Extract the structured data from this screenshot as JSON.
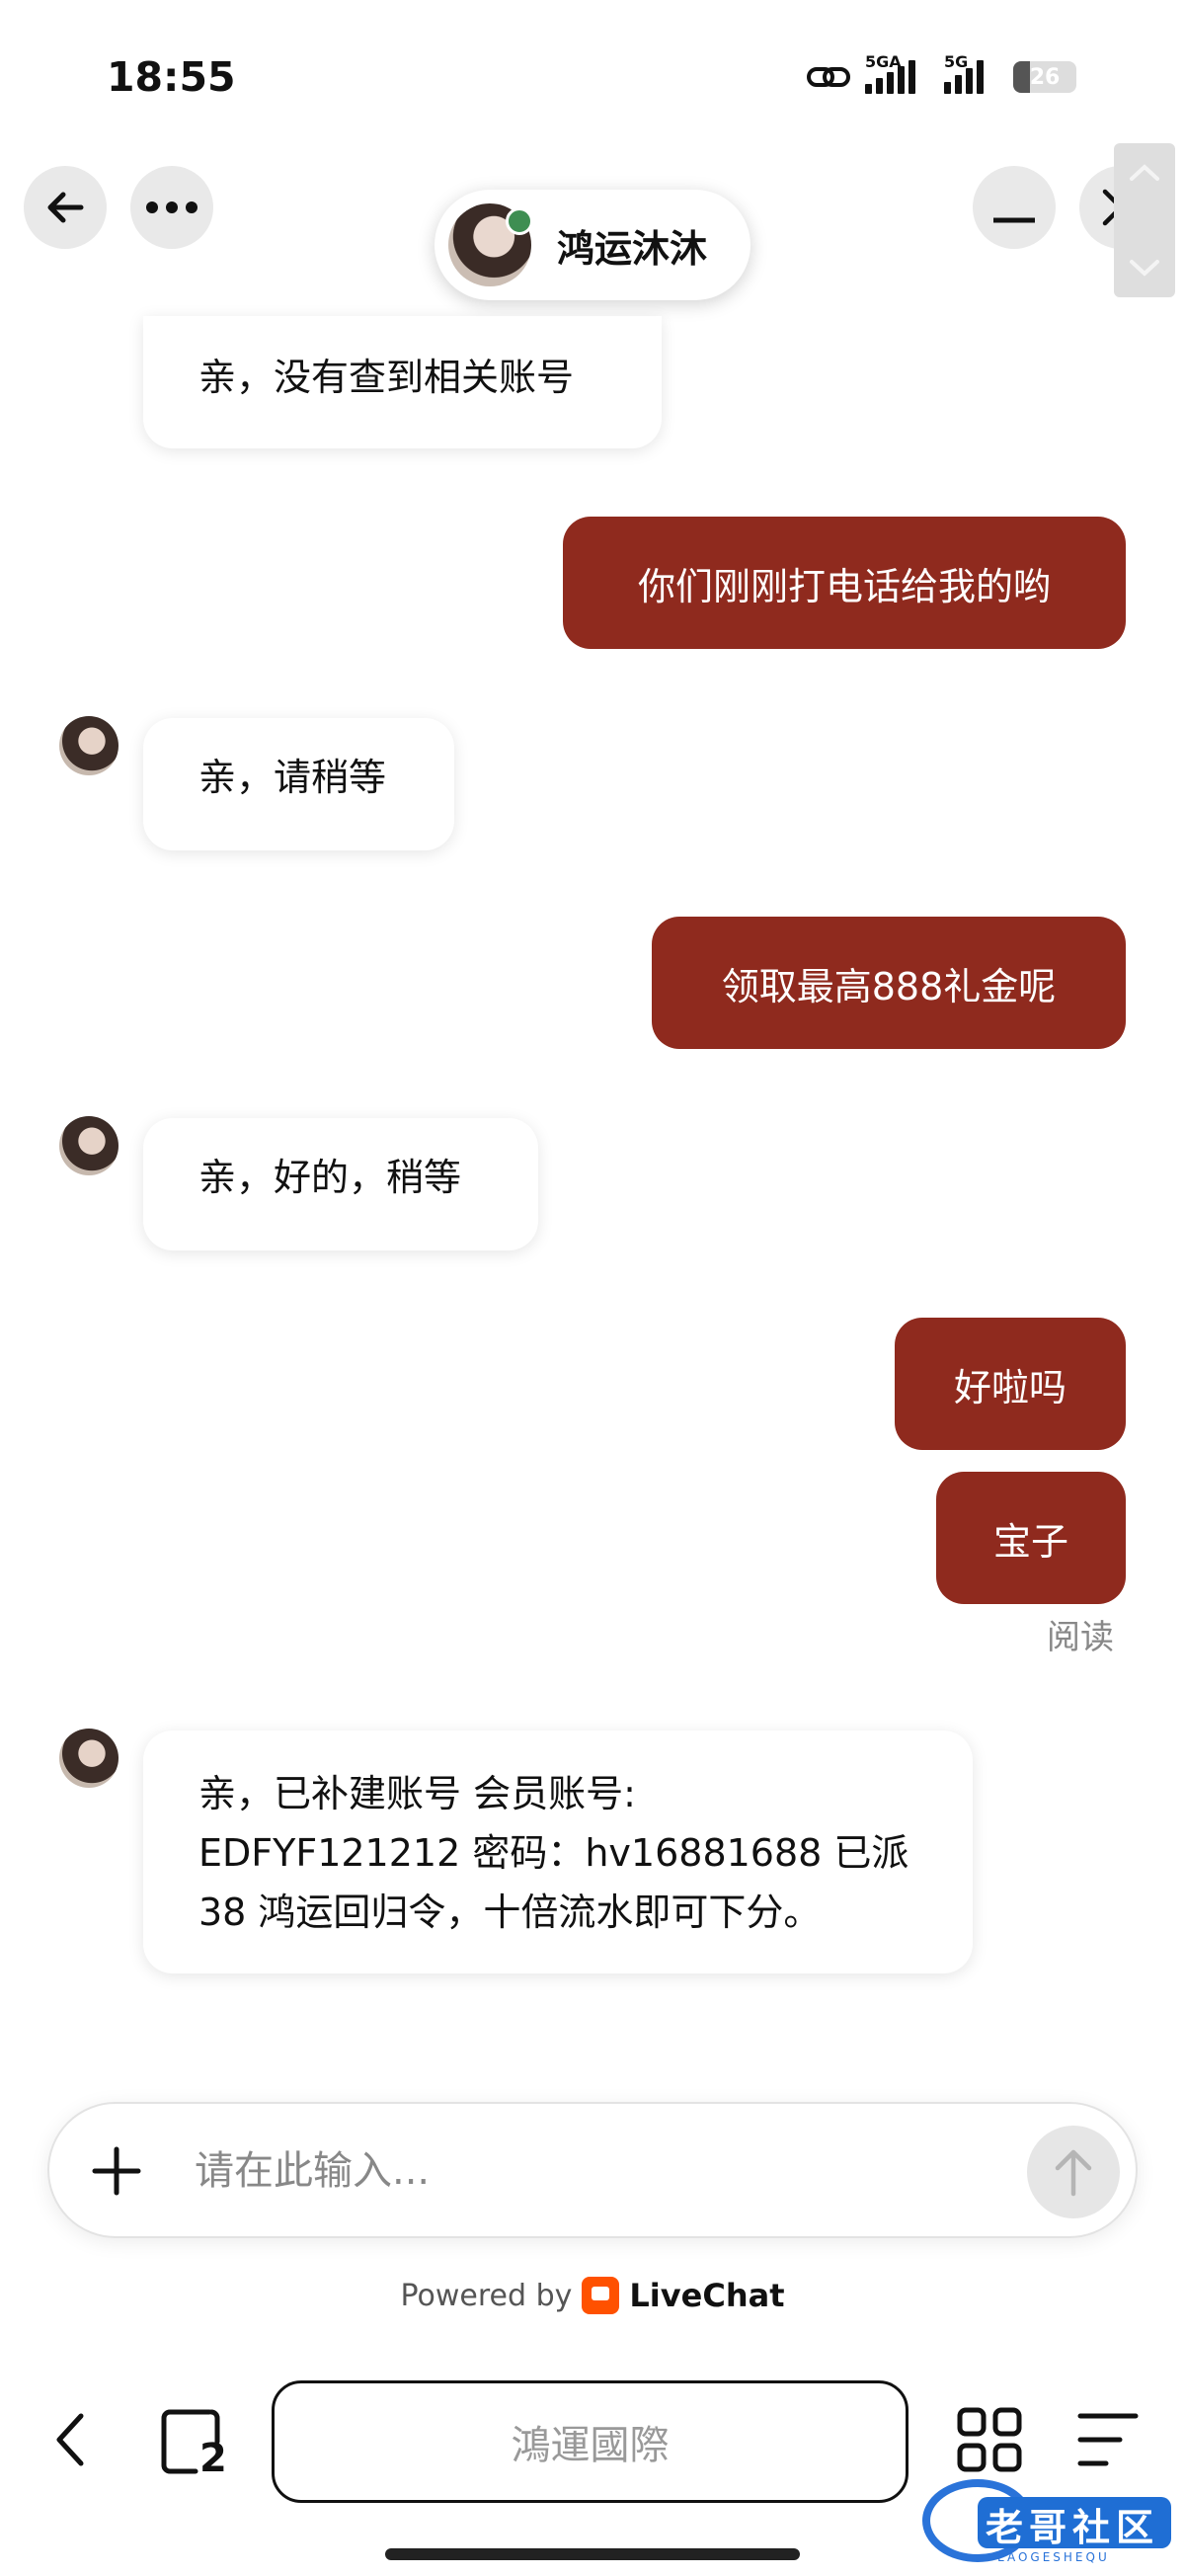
{
  "status_bar": {
    "time": "18:55",
    "signal1_label": "5GA",
    "signal2_label": "5G",
    "battery": "26",
    "battery_level": 0.26
  },
  "header": {
    "agent_name": "鸿运沐沐",
    "agent_online": true
  },
  "messages": [
    {
      "from": "agent",
      "text": "亲，没有查到相关账号"
    },
    {
      "from": "user",
      "text": "你们刚刚打电话给我的哟"
    },
    {
      "from": "agent",
      "text": "亲，请稍等"
    },
    {
      "from": "user",
      "text": "领取最高888礼金呢"
    },
    {
      "from": "agent",
      "text": "亲，好的，稍等"
    },
    {
      "from": "user",
      "text": "好啦吗"
    },
    {
      "from": "user",
      "text": "宝子"
    },
    {
      "from": "agent",
      "lines": [
        "亲，已补建账号 会员账号:",
        "EDFYF121212 密码：hv16881688 已派",
        "38 鸿运回归令，十倍流水即可下分。"
      ]
    }
  ],
  "read_status": "阅读",
  "composer": {
    "placeholder": "请在此输入..."
  },
  "footer": {
    "powered_by": "Powered by",
    "brand": "LiveChat"
  },
  "browser": {
    "url_label": "鴻運國際",
    "tab_count": "2"
  },
  "watermark": {
    "text": "老哥社区",
    "subtext": "LAOGESHEQU"
  },
  "colors": {
    "accent": "#8f2a1e",
    "online": "#3e8e52"
  }
}
